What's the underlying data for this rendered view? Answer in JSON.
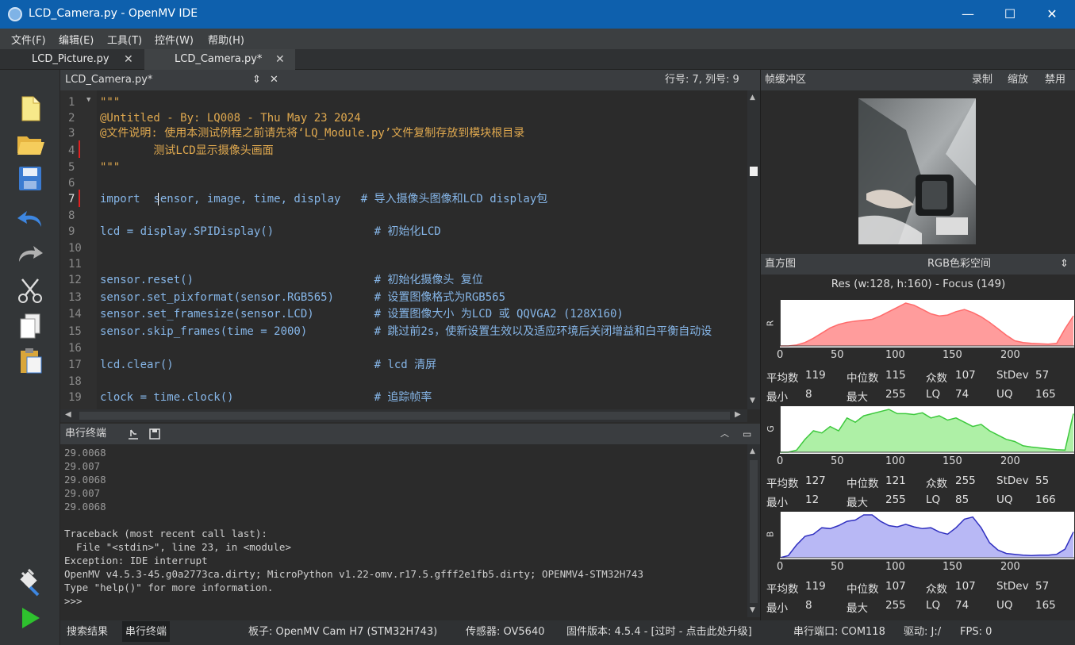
{
  "window": {
    "title": "LCD_Camera.py - OpenMV IDE",
    "minimize": "—",
    "maximize": "☐",
    "close": "✕"
  },
  "menu": [
    "文件(F)",
    "编辑(E)",
    "工具(T)",
    "控件(W)",
    "帮助(H)"
  ],
  "file_tabs": [
    {
      "label": "LCD_Picture.py",
      "close": "✕"
    },
    {
      "label": "LCD_Camera.py*",
      "close": "✕"
    }
  ],
  "editor_header": {
    "file": "LCD_Camera.py*",
    "position": "行号: 7, 列号: 9",
    "updown": "⇕",
    "close": "✕"
  },
  "code_lines": [
    "\"\"\"",
    "@Untitled - By: LQ008 - Thu May 23 2024",
    "@文件说明: 使用本测试例程之前请先将‘LQ_Module.py’文件复制存放到模块根目录",
    "        测试LCD显示摄像头画面",
    "\"\"\"",
    "",
    "import  sensor, image, time, display   # 导入摄像头图像和LCD display包",
    "",
    "lcd = display.SPIDisplay()               # 初始化LCD",
    "",
    "",
    "sensor.reset()                           # 初始化摄像头 复位",
    "sensor.set_pixformat(sensor.RGB565)      # 设置图像格式为RGB565",
    "sensor.set_framesize(sensor.LCD)         # 设置图像大小 为LCD 或 QQVGA2 (128X160)",
    "sensor.skip_frames(time = 2000)          # 跳过前2s，使新设置生效以及适应环境后关闭增益和白平衡自动设",
    "",
    "lcd.clear()                              # lcd 清屏",
    "",
    "clock = time.clock()                     # 追踪帧率"
  ],
  "line_numbers": [
    "1",
    "2",
    "3",
    "4",
    "5",
    "6",
    "7",
    "8",
    "9",
    "10",
    "11",
    "12",
    "13",
    "14",
    "15",
    "16",
    "17",
    "18",
    "19"
  ],
  "terminal": {
    "title": "串行终端",
    "lines": [
      "29.0068",
      "29.007",
      "29.0068",
      "29.007",
      "29.0068",
      "",
      "Traceback (most recent call last):",
      "  File \"<stdin>\", line 23, in <module>",
      "Exception: IDE interrupt",
      "OpenMV v4.5.3-45.g0a2773ca.dirty; MicroPython v1.22-omv.r17.5.gfff2e1fb5.dirty; OPENMV4-STM32H743",
      "Type \"help()\" for more information.",
      ">>>"
    ]
  },
  "framebuffer": {
    "title": "帧缓冲区",
    "record": "录制",
    "zoom": "缩放",
    "disable": "禁用"
  },
  "histogram": {
    "title": "直方图",
    "colorspace": "RGB色彩空间",
    "res": "Res (w:128, h:160) - Focus (149)",
    "x_ticks": [
      "0",
      "50",
      "100",
      "150",
      "200"
    ],
    "channels": [
      {
        "label": "R",
        "color": "#ff9c9c",
        "line": "#ff6b6b",
        "mean": "119",
        "median": "115",
        "mode": "107",
        "stdev": "57",
        "min": "8",
        "max": "255",
        "lq": "74",
        "uq": "165",
        "values": [
          0,
          0,
          0.02,
          0.08,
          0.18,
          0.3,
          0.42,
          0.5,
          0.55,
          0.58,
          0.6,
          0.62,
          0.7,
          0.8,
          0.9,
          1.0,
          0.95,
          0.85,
          0.75,
          0.7,
          0.72,
          0.8,
          0.85,
          0.78,
          0.68,
          0.55,
          0.4,
          0.25,
          0.12,
          0.08,
          0.06,
          0.05,
          0.04,
          0.06,
          0.4,
          0.7
        ]
      },
      {
        "label": "G",
        "color": "#aef0a6",
        "line": "#3ec93e",
        "mean": "127",
        "median": "121",
        "mode": "255",
        "stdev": "55",
        "min": "12",
        "max": "255",
        "lq": "85",
        "uq": "166",
        "values": [
          0,
          0,
          0.05,
          0.3,
          0.5,
          0.45,
          0.6,
          0.5,
          0.8,
          0.7,
          0.85,
          0.9,
          0.95,
          1.0,
          0.9,
          0.9,
          0.88,
          0.92,
          0.8,
          0.85,
          0.75,
          0.8,
          0.7,
          0.6,
          0.65,
          0.5,
          0.4,
          0.3,
          0.25,
          0.15,
          0.12,
          0.1,
          0.08,
          0.06,
          0.05,
          0.9
        ]
      },
      {
        "label": "B",
        "color": "#b8b8f5",
        "line": "#3030c0",
        "mean": "119",
        "median": "107",
        "mode": "107",
        "stdev": "57",
        "min": "8",
        "max": "255",
        "lq": "74",
        "uq": "165",
        "values": [
          0,
          0.05,
          0.3,
          0.5,
          0.55,
          0.7,
          0.68,
          0.75,
          0.85,
          0.88,
          1.0,
          1.0,
          0.85,
          0.75,
          0.72,
          0.78,
          0.72,
          0.68,
          0.7,
          0.6,
          0.55,
          0.7,
          0.9,
          0.95,
          0.7,
          0.35,
          0.18,
          0.1,
          0.08,
          0.06,
          0.05,
          0.06,
          0.06,
          0.08,
          0.2,
          0.6
        ]
      }
    ],
    "stat_labels": {
      "mean": "平均数",
      "median": "中位数",
      "mode": "众数",
      "stdev": "StDev",
      "min": "最小",
      "max": "最大",
      "lq": "LQ",
      "uq": "UQ"
    }
  },
  "status": {
    "search": "搜索结果",
    "serial": "串行终端",
    "board": "板子: OpenMV Cam H7 (STM32H743)",
    "sensor": "传感器: OV5640",
    "firmware": "固件版本: 4.5.4 - [过时 - 点击此处升级]",
    "port": "串行端口: COM118",
    "drive": "驱动: J:/",
    "fps": "FPS: 0"
  }
}
